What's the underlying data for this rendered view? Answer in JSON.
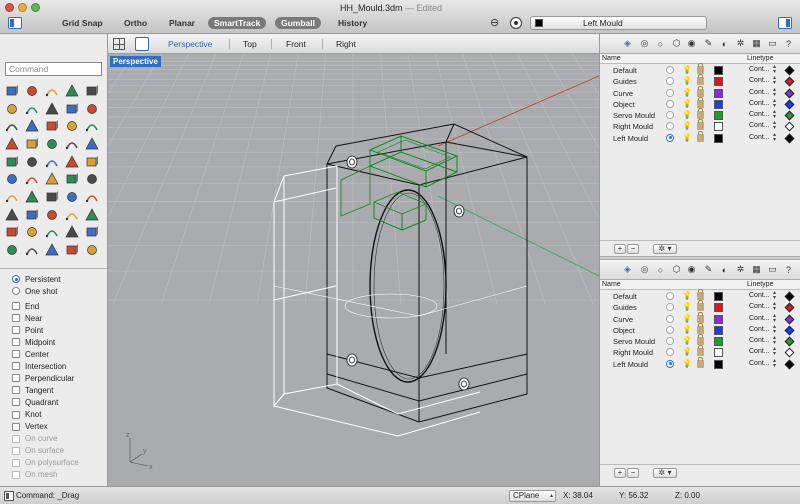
{
  "window": {
    "title": "HH_Mould.3dm",
    "status": "— Edited"
  },
  "toolbar": {
    "modes": [
      {
        "label": "Grid Snap",
        "active": false
      },
      {
        "label": "Ortho",
        "active": false
      },
      {
        "label": "Planar",
        "active": false
      },
      {
        "label": "SmartTrack",
        "active": true
      },
      {
        "label": "Gumball",
        "active": true
      },
      {
        "label": "History",
        "active": false
      }
    ],
    "current_layer": "Left Mould"
  },
  "command": {
    "placeholder": "Command"
  },
  "tools": [
    "select-arrow",
    "point",
    "polyline",
    "curve",
    "arc",
    "circle",
    "rectangle",
    "polygon",
    "fillet-curve",
    "ellipse",
    "surface-edge",
    "extrude-surface",
    "sweep",
    "loft",
    "revolve",
    "solid-box",
    "sphere",
    "cone",
    "cylinder",
    "torus",
    "boolean-union",
    "boolean-difference",
    "explode",
    "join",
    "offset",
    "trim",
    "split",
    "group",
    "ungroup",
    "mirror",
    "move",
    "copy",
    "rotate",
    "scale",
    "array",
    "pipe",
    "patch",
    "network-srf",
    "blend",
    "match",
    "dimension",
    "text",
    "hatch",
    "leader",
    "light",
    "analyze-dir",
    "car",
    "zebra",
    "camera",
    "render"
  ],
  "snaps": {
    "modes": [
      {
        "label": "Persistent",
        "selected": true
      },
      {
        "label": "One shot",
        "selected": false
      }
    ],
    "osnaps": [
      {
        "label": "End",
        "enabled": true
      },
      {
        "label": "Near",
        "enabled": true
      },
      {
        "label": "Point",
        "enabled": true
      },
      {
        "label": "Midpoint",
        "enabled": true
      },
      {
        "label": "Center",
        "enabled": true
      },
      {
        "label": "Intersection",
        "enabled": true
      },
      {
        "label": "Perpendicular",
        "enabled": true
      },
      {
        "label": "Tangent",
        "enabled": true
      },
      {
        "label": "Quadrant",
        "enabled": true
      },
      {
        "label": "Knot",
        "enabled": true
      },
      {
        "label": "Vertex",
        "enabled": true
      },
      {
        "label": "On curve",
        "enabled": false
      },
      {
        "label": "On surface",
        "enabled": false
      },
      {
        "label": "On polysurface",
        "enabled": false
      },
      {
        "label": "On mesh",
        "enabled": false
      }
    ]
  },
  "viewports": {
    "tabs": [
      {
        "label": "Perspective",
        "active": true
      },
      {
        "label": "Top",
        "active": false
      },
      {
        "label": "Front",
        "active": false
      },
      {
        "label": "Right",
        "active": false
      }
    ],
    "active_label": "Perspective"
  },
  "layers": {
    "header_name": "Name",
    "header_linetype": "Linetype",
    "rows": [
      {
        "name": "Default",
        "color": "#000000",
        "linetype": "Cont...",
        "current": false,
        "diamond": "#000000",
        "bulb_on": true
      },
      {
        "name": "Guides",
        "color": "#e3141b",
        "linetype": "Cont...",
        "current": false,
        "diamond": "#e3141b",
        "bulb_on": false
      },
      {
        "name": "Curve",
        "color": "#8a2be2",
        "linetype": "Cont...",
        "current": false,
        "diamond": "#8a2be2",
        "bulb_on": false
      },
      {
        "name": "Object",
        "color": "#1c3fe0",
        "linetype": "Cont...",
        "current": false,
        "diamond": "#1c3fe0",
        "bulb_on": false
      },
      {
        "name": "Servo Mould",
        "color": "#17a02a",
        "linetype": "Cont...",
        "current": false,
        "diamond": "#17a02a",
        "bulb_on": true
      },
      {
        "name": "Right Mould",
        "color": "#ffffff",
        "linetype": "Cont...",
        "current": false,
        "diamond": "#ffffff",
        "bulb_on": true
      },
      {
        "name": "Left Mould",
        "color": "#000000",
        "linetype": "Cont...",
        "current": true,
        "diamond": "#000000",
        "bulb_on": false
      }
    ],
    "footer": {
      "add": "+",
      "remove": "−",
      "options": "✲ ▾"
    }
  },
  "status": {
    "command_echo": "Command: _Drag",
    "cplane": "CPlane",
    "x": "X: 38.04",
    "y": "Y: 56.32",
    "z": "Z: 0.00"
  },
  "colors": {
    "accent": "#2f6fc1",
    "servo_mould_green": "#17a02a",
    "x_axis": "#c0392b",
    "y_axis": "#27ae60",
    "viewport_bg": "#a9abae"
  }
}
